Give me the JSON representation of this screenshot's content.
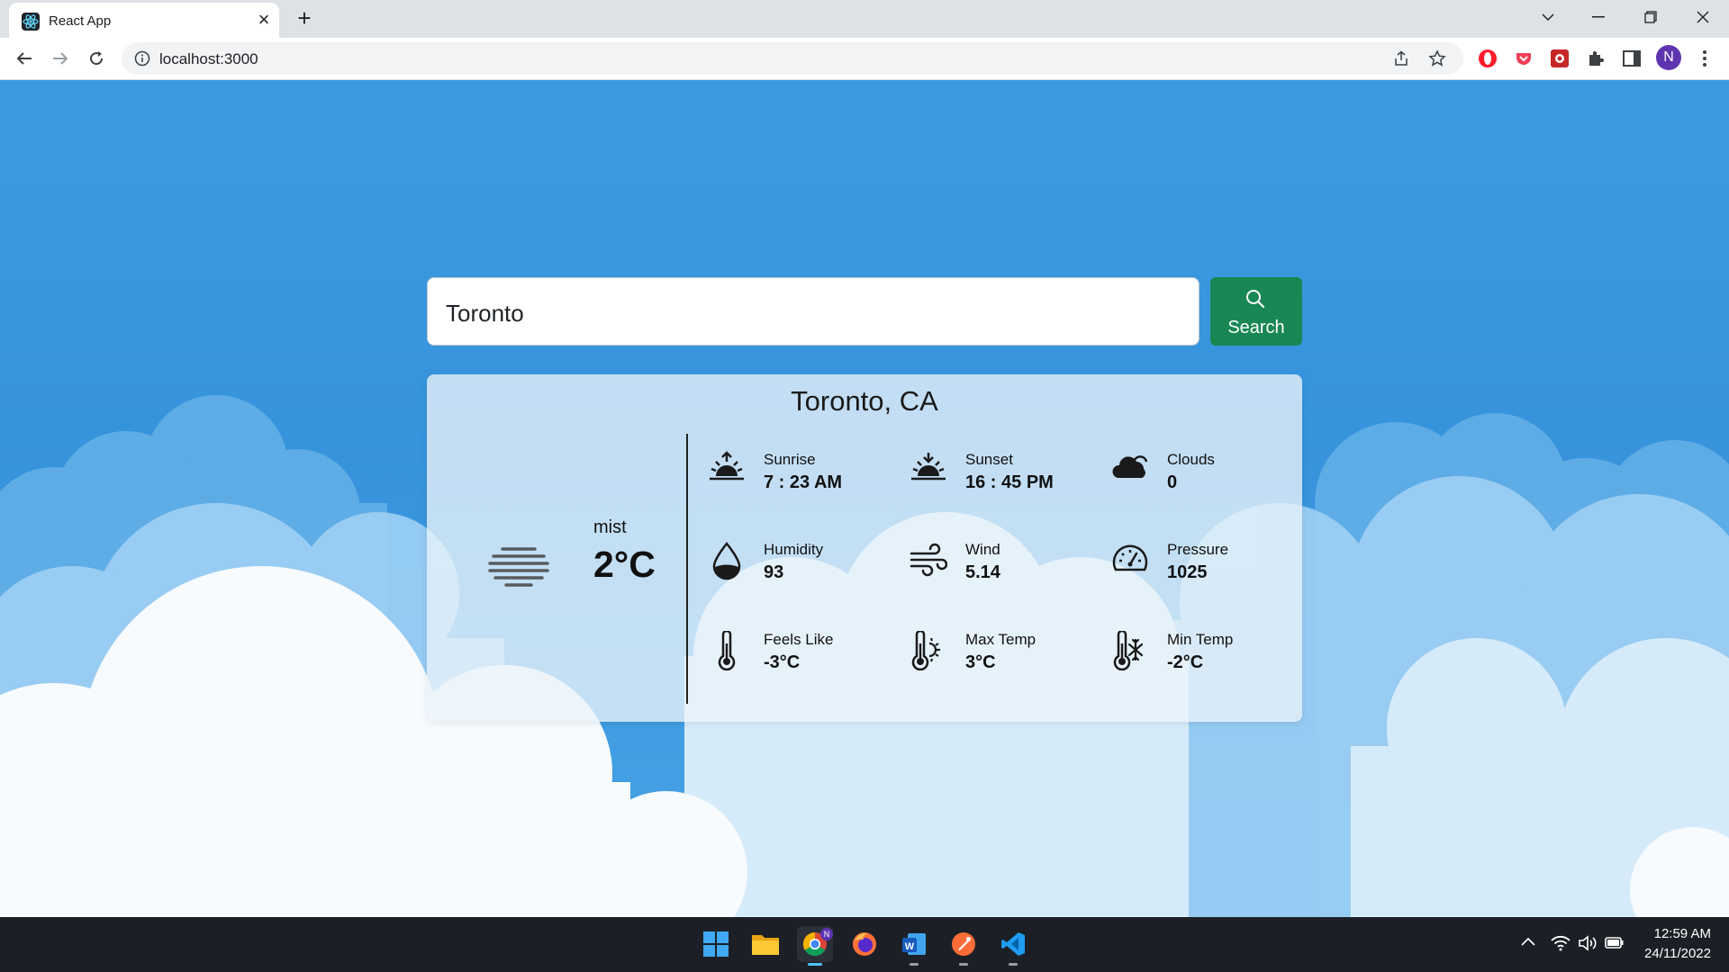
{
  "browser": {
    "tab_title": "React App",
    "url": "localhost:3000",
    "profile_initial": "N"
  },
  "search": {
    "value": "Toronto",
    "button_label": "Search"
  },
  "weather": {
    "location": "Toronto, CA",
    "condition": "mist",
    "temperature": "2°C",
    "stats": [
      {
        "label": "Sunrise",
        "value": "7 : 23 AM",
        "icon": "sunrise-icon"
      },
      {
        "label": "Sunset",
        "value": "16 : 45 PM",
        "icon": "sunset-icon"
      },
      {
        "label": "Clouds",
        "value": "0",
        "icon": "clouds-icon"
      },
      {
        "label": "Humidity",
        "value": "93",
        "icon": "humidity-icon"
      },
      {
        "label": "Wind",
        "value": "5.14",
        "icon": "wind-icon"
      },
      {
        "label": "Pressure",
        "value": "1025",
        "icon": "pressure-gauge-icon"
      },
      {
        "label": "Feels Like",
        "value": "-3°C",
        "icon": "thermometer-icon"
      },
      {
        "label": "Max Temp",
        "value": "3°C",
        "icon": "thermometer-sun-icon"
      },
      {
        "label": "Min Temp",
        "value": "-2°C",
        "icon": "thermometer-snow-icon"
      }
    ]
  },
  "taskbar": {
    "time": "12:59 AM",
    "date": "24/11/2022",
    "apps": [
      "windows-start-icon",
      "file-explorer-icon",
      "chrome-icon",
      "firefox-icon",
      "word-icon",
      "postman-icon",
      "vscode-icon"
    ]
  },
  "colors": {
    "page_sky": "#3a97dc",
    "search_button": "#198754",
    "card_background": "#ebf3fa"
  }
}
